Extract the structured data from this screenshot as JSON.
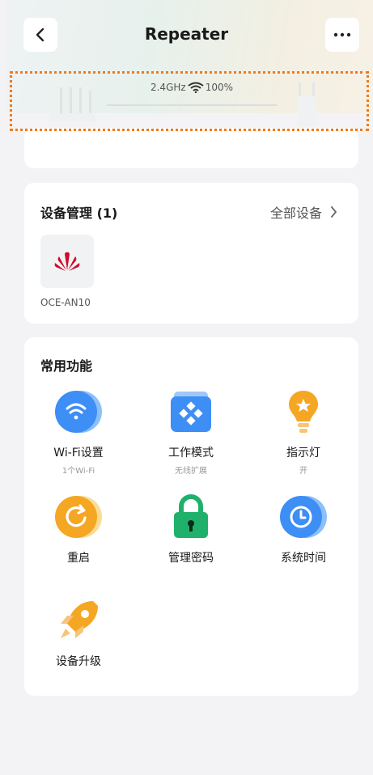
{
  "header": {
    "title": "Repeater"
  },
  "topology": {
    "band": "2.4GHz",
    "signal": "100%"
  },
  "device_management": {
    "title": "设备管理 (1)",
    "all_label": "全部设备",
    "devices": [
      {
        "name": "OCE-AN10"
      }
    ]
  },
  "functions": {
    "title": "常用功能",
    "items": [
      {
        "label": "Wi-Fi设置",
        "sub": "1个Wi-Fi"
      },
      {
        "label": "工作模式",
        "sub": "无线扩展"
      },
      {
        "label": "指示灯",
        "sub": "开"
      },
      {
        "label": "重启",
        "sub": ""
      },
      {
        "label": "管理密码",
        "sub": ""
      },
      {
        "label": "系统时间",
        "sub": ""
      },
      {
        "label": "设备升级",
        "sub": ""
      }
    ]
  },
  "colors": {
    "highlight": "#f07a1a",
    "brand_red": "#cf0a2c",
    "blue": "#3d8ef5",
    "orange": "#f5a623",
    "green": "#1fb16b"
  }
}
